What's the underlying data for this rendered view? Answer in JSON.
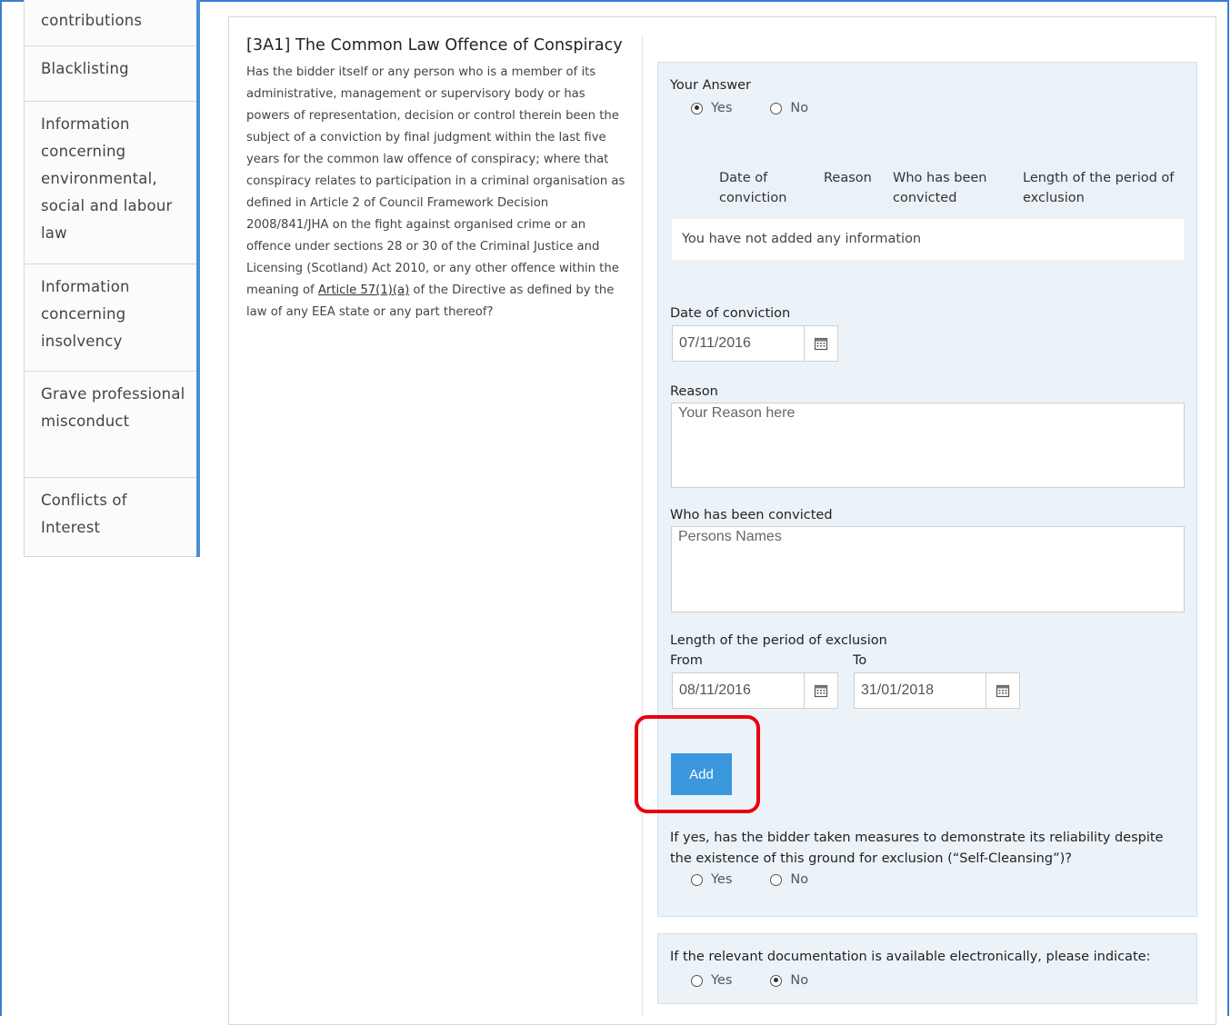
{
  "sidebar": {
    "items": [
      {
        "label": "contributions"
      },
      {
        "label": "Blacklisting"
      },
      {
        "label": "Information concerning environmental, social and labour law"
      },
      {
        "label": "Information concerning insolvency"
      },
      {
        "label": "Grave professional misconduct"
      },
      {
        "label": "Conflicts of Interest"
      }
    ]
  },
  "question": {
    "title": "[3A1] The Common Law Offence of Conspiracy",
    "text_before_link": "Has the bidder itself or any person who is a member of its administrative, management or supervisory body or has powers of representation, decision or control therein been the subject of a conviction by final judgment within the last five years for the common law offence of conspiracy; where that conspiracy relates to participation in a criminal organisation as defined in Article 2 of Council Framework Decision 2008/841/JHA on the fight against organised crime or an offence under sections 28 or 30 of the Criminal Justice and Licensing (Scotland) Act 2010, or any other offence within the meaning  of ",
    "link_text": "Article 57(1)(a)",
    "text_after_link": " of the Directive as defined by the law of any EEA state or any part thereof?"
  },
  "answer": {
    "label": "Your Answer",
    "yes": "Yes",
    "no": "No",
    "selected": "yes"
  },
  "table": {
    "headers": [
      "Date of conviction",
      "Reason",
      "Who has been convicted",
      "Length of the period of exclusion"
    ],
    "empty_text": "You have not added any information"
  },
  "form": {
    "date_label": "Date of conviction",
    "date_value": "07/11/2016",
    "reason_label": "Reason",
    "reason_placeholder": "Your Reason here",
    "convicted_label": "Who has been convicted",
    "convicted_placeholder": "Persons Names",
    "period_label": "Length of the period of exclusion",
    "from_label": "From",
    "from_value": "08/11/2016",
    "to_label": "To",
    "to_value": "31/01/2018",
    "add_label": "Add"
  },
  "self_cleansing": {
    "question": "If yes, has the bidder taken measures to demonstrate its reliability despite the existence of this ground for exclusion (“Self-Cleansing”)?",
    "yes": "Yes",
    "no": "No",
    "selected": "none"
  },
  "documentation": {
    "question": "If the relevant documentation is available electronically, please indicate:",
    "yes": "Yes",
    "no": "No",
    "selected": "no"
  },
  "colors": {
    "accent": "#3b97de",
    "highlight": "#e8000d",
    "panel": "#ebf2f8"
  }
}
